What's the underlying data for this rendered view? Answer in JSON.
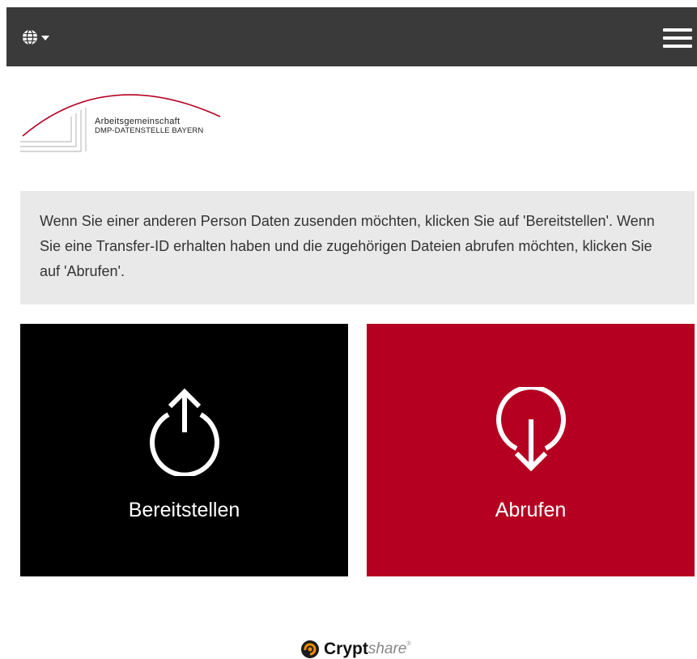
{
  "header": {
    "language_icon": "globe-icon",
    "caret_icon": "caret-down-icon",
    "menu_icon": "hamburger-menu-icon",
    "background_color": "#3a3a3a"
  },
  "logo": {
    "line1": "Arbeitsgemeinschaft",
    "line2": "DMP-DATENSTELLE BAYERN",
    "arc_color": "#b50022"
  },
  "info": {
    "text": "Wenn Sie einer anderen Person Daten zusenden möchten, klicken Sie auf 'Bereitstellen'. Wenn Sie eine Transfer-ID erhalten haben und die zugehörigen Dateien abrufen möchten, klicken Sie auf 'Abrufen'."
  },
  "actions": {
    "provide": {
      "label": "Bereitstellen",
      "icon": "upload-power-icon",
      "color": "#000000"
    },
    "retrieve": {
      "label": "Abrufen",
      "icon": "download-pin-icon",
      "color": "#b50022"
    }
  },
  "footer": {
    "brand_bold": "Crypt",
    "brand_light": "share",
    "registered": "®",
    "logo_icon": "cryptshare-logo-icon"
  }
}
